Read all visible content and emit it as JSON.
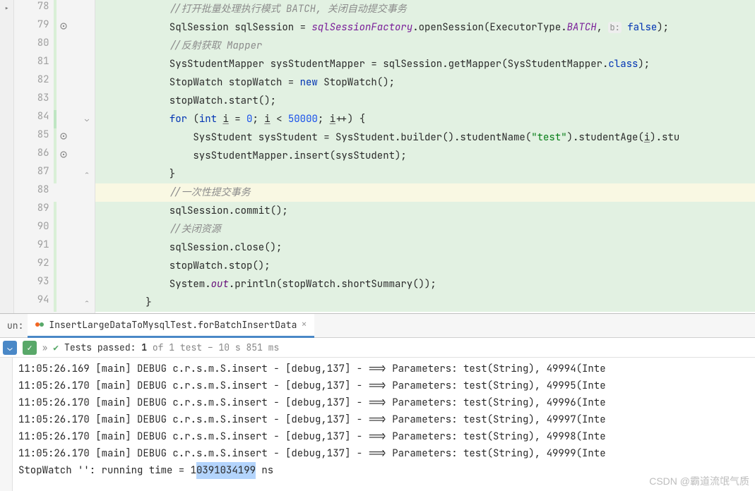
{
  "code": {
    "lines": [
      {
        "n": 78,
        "bg": "green",
        "strip": "light",
        "marks": [],
        "fold": "",
        "tokens": [
          [
            "com",
            "            //"
          ],
          [
            "com-cn",
            "打开批量处理执行模式 BATCH, 关闭自动提交事务"
          ]
        ]
      },
      {
        "n": 79,
        "bg": "green",
        "strip": "light",
        "marks": [
          "gear"
        ],
        "fold": "",
        "tokens": [
          [
            "ident",
            "            SqlSession sqlSession = "
          ],
          [
            "field",
            "sqlSessionFactory"
          ],
          [
            "ident",
            ".openSession(ExecutorType."
          ],
          [
            "static",
            "BATCH"
          ],
          [
            "ident",
            ", "
          ],
          [
            "param-hint",
            "b:"
          ],
          [
            "ident",
            " "
          ],
          [
            "kw",
            "false"
          ],
          [
            "ident",
            ");"
          ]
        ]
      },
      {
        "n": 80,
        "bg": "green",
        "strip": "light",
        "marks": [],
        "fold": "",
        "tokens": [
          [
            "com",
            "            //"
          ],
          [
            "com-cn",
            "反射获取 Mapper"
          ]
        ]
      },
      {
        "n": 81,
        "bg": "green",
        "strip": "light",
        "marks": [],
        "fold": "",
        "tokens": [
          [
            "ident",
            "            SysStudentMapper sysStudentMapper = sqlSession.getMapper(SysStudentMapper."
          ],
          [
            "kw",
            "class"
          ],
          [
            "ident",
            ");"
          ]
        ]
      },
      {
        "n": 82,
        "bg": "green",
        "strip": "light",
        "marks": [],
        "fold": "",
        "tokens": [
          [
            "ident",
            "            StopWatch stopWatch = "
          ],
          [
            "kw",
            "new"
          ],
          [
            "ident",
            " StopWatch();"
          ]
        ]
      },
      {
        "n": 83,
        "bg": "green",
        "strip": "light",
        "marks": [],
        "fold": "",
        "tokens": [
          [
            "ident",
            "            stopWatch.start();"
          ]
        ]
      },
      {
        "n": 84,
        "bg": "green",
        "strip": "green",
        "marks": [],
        "fold": "down",
        "tokens": [
          [
            "ident",
            "            "
          ],
          [
            "kw",
            "for"
          ],
          [
            "ident",
            " ("
          ],
          [
            "kw",
            "int"
          ],
          [
            "ident",
            " "
          ],
          [
            "underline",
            "i"
          ],
          [
            "ident",
            " = "
          ],
          [
            "num",
            "0"
          ],
          [
            "ident",
            "; "
          ],
          [
            "underline",
            "i"
          ],
          [
            "ident",
            " < "
          ],
          [
            "num",
            "50000"
          ],
          [
            "ident",
            "; "
          ],
          [
            "underline",
            "i"
          ],
          [
            "ident",
            "++) {"
          ]
        ]
      },
      {
        "n": 85,
        "bg": "green",
        "strip": "light",
        "marks": [
          "gear"
        ],
        "fold": "",
        "tokens": [
          [
            "ident",
            "                SysStudent sysStudent = SysStudent."
          ],
          [
            "ident",
            "builder"
          ],
          [
            "ident",
            "().studentName("
          ],
          [
            "str",
            "\"test\""
          ],
          [
            "ident",
            ").studentAge("
          ],
          [
            "underline",
            "i"
          ],
          [
            "ident",
            ").stu"
          ]
        ]
      },
      {
        "n": 86,
        "bg": "green",
        "strip": "light",
        "marks": [
          "gear"
        ],
        "fold": "",
        "tokens": [
          [
            "ident",
            "                sysStudentMapper.insert(sysStudent);"
          ]
        ]
      },
      {
        "n": 87,
        "bg": "green",
        "strip": "light",
        "marks": [],
        "fold": "up",
        "tokens": [
          [
            "ident",
            "            }"
          ]
        ]
      },
      {
        "n": 88,
        "bg": "yellow",
        "strip": "",
        "marks": [],
        "fold": "",
        "tokens": [
          [
            "com",
            "            //"
          ],
          [
            "com-cn",
            "一次性提交事务"
          ]
        ]
      },
      {
        "n": 89,
        "bg": "green",
        "strip": "light",
        "marks": [],
        "fold": "",
        "tokens": [
          [
            "ident",
            "            sqlSession.commit();"
          ]
        ]
      },
      {
        "n": 90,
        "bg": "green",
        "strip": "light",
        "marks": [],
        "fold": "",
        "tokens": [
          [
            "com",
            "            //"
          ],
          [
            "com-cn",
            "关闭资源"
          ]
        ]
      },
      {
        "n": 91,
        "bg": "green",
        "strip": "light",
        "marks": [],
        "fold": "",
        "tokens": [
          [
            "ident",
            "            sqlSession.close();"
          ]
        ]
      },
      {
        "n": 92,
        "bg": "green",
        "strip": "light",
        "marks": [],
        "fold": "",
        "tokens": [
          [
            "ident",
            "            stopWatch.stop();"
          ]
        ]
      },
      {
        "n": 93,
        "bg": "green",
        "strip": "light",
        "marks": [],
        "fold": "",
        "tokens": [
          [
            "ident",
            "            System."
          ],
          [
            "out-italic",
            "out"
          ],
          [
            "ident",
            ".println(stopWatch.shortSummary());"
          ]
        ]
      },
      {
        "n": 94,
        "bg": "green",
        "strip": "light",
        "marks": [],
        "fold": "up",
        "tokens": [
          [
            "ident",
            "        }"
          ]
        ]
      }
    ]
  },
  "run": {
    "label": "un:",
    "tab": {
      "name": "InsertLargeDataToMysqlTest.forBatchInsertData"
    },
    "status": {
      "prefix": "Tests passed:",
      "count": "1",
      "rest": " of 1 test – 10 s 851 ms"
    }
  },
  "console": {
    "rows": [
      "11:05:26.169 [main] DEBUG c.r.s.m.S.insert - [debug,137] - ==> Parameters: test(String), 49994(Inte",
      "11:05:26.170 [main] DEBUG c.r.s.m.S.insert - [debug,137] - ==> Parameters: test(String), 49995(Inte",
      "11:05:26.170 [main] DEBUG c.r.s.m.S.insert - [debug,137] - ==> Parameters: test(String), 49996(Inte",
      "11:05:26.170 [main] DEBUG c.r.s.m.S.insert - [debug,137] - ==> Parameters: test(String), 49997(Inte",
      "11:05:26.170 [main] DEBUG c.r.s.m.S.insert - [debug,137] - ==> Parameters: test(String), 49998(Inte",
      "11:05:26.170 [main] DEBUG c.r.s.m.S.insert - [debug,137] - ==> Parameters: test(String), 49999(Inte"
    ],
    "final_prefix": "StopWatch '': running time = 1",
    "final_selected": "0391034199",
    "final_suffix": " ns"
  },
  "watermark": "CSDN @霸道流氓气质"
}
